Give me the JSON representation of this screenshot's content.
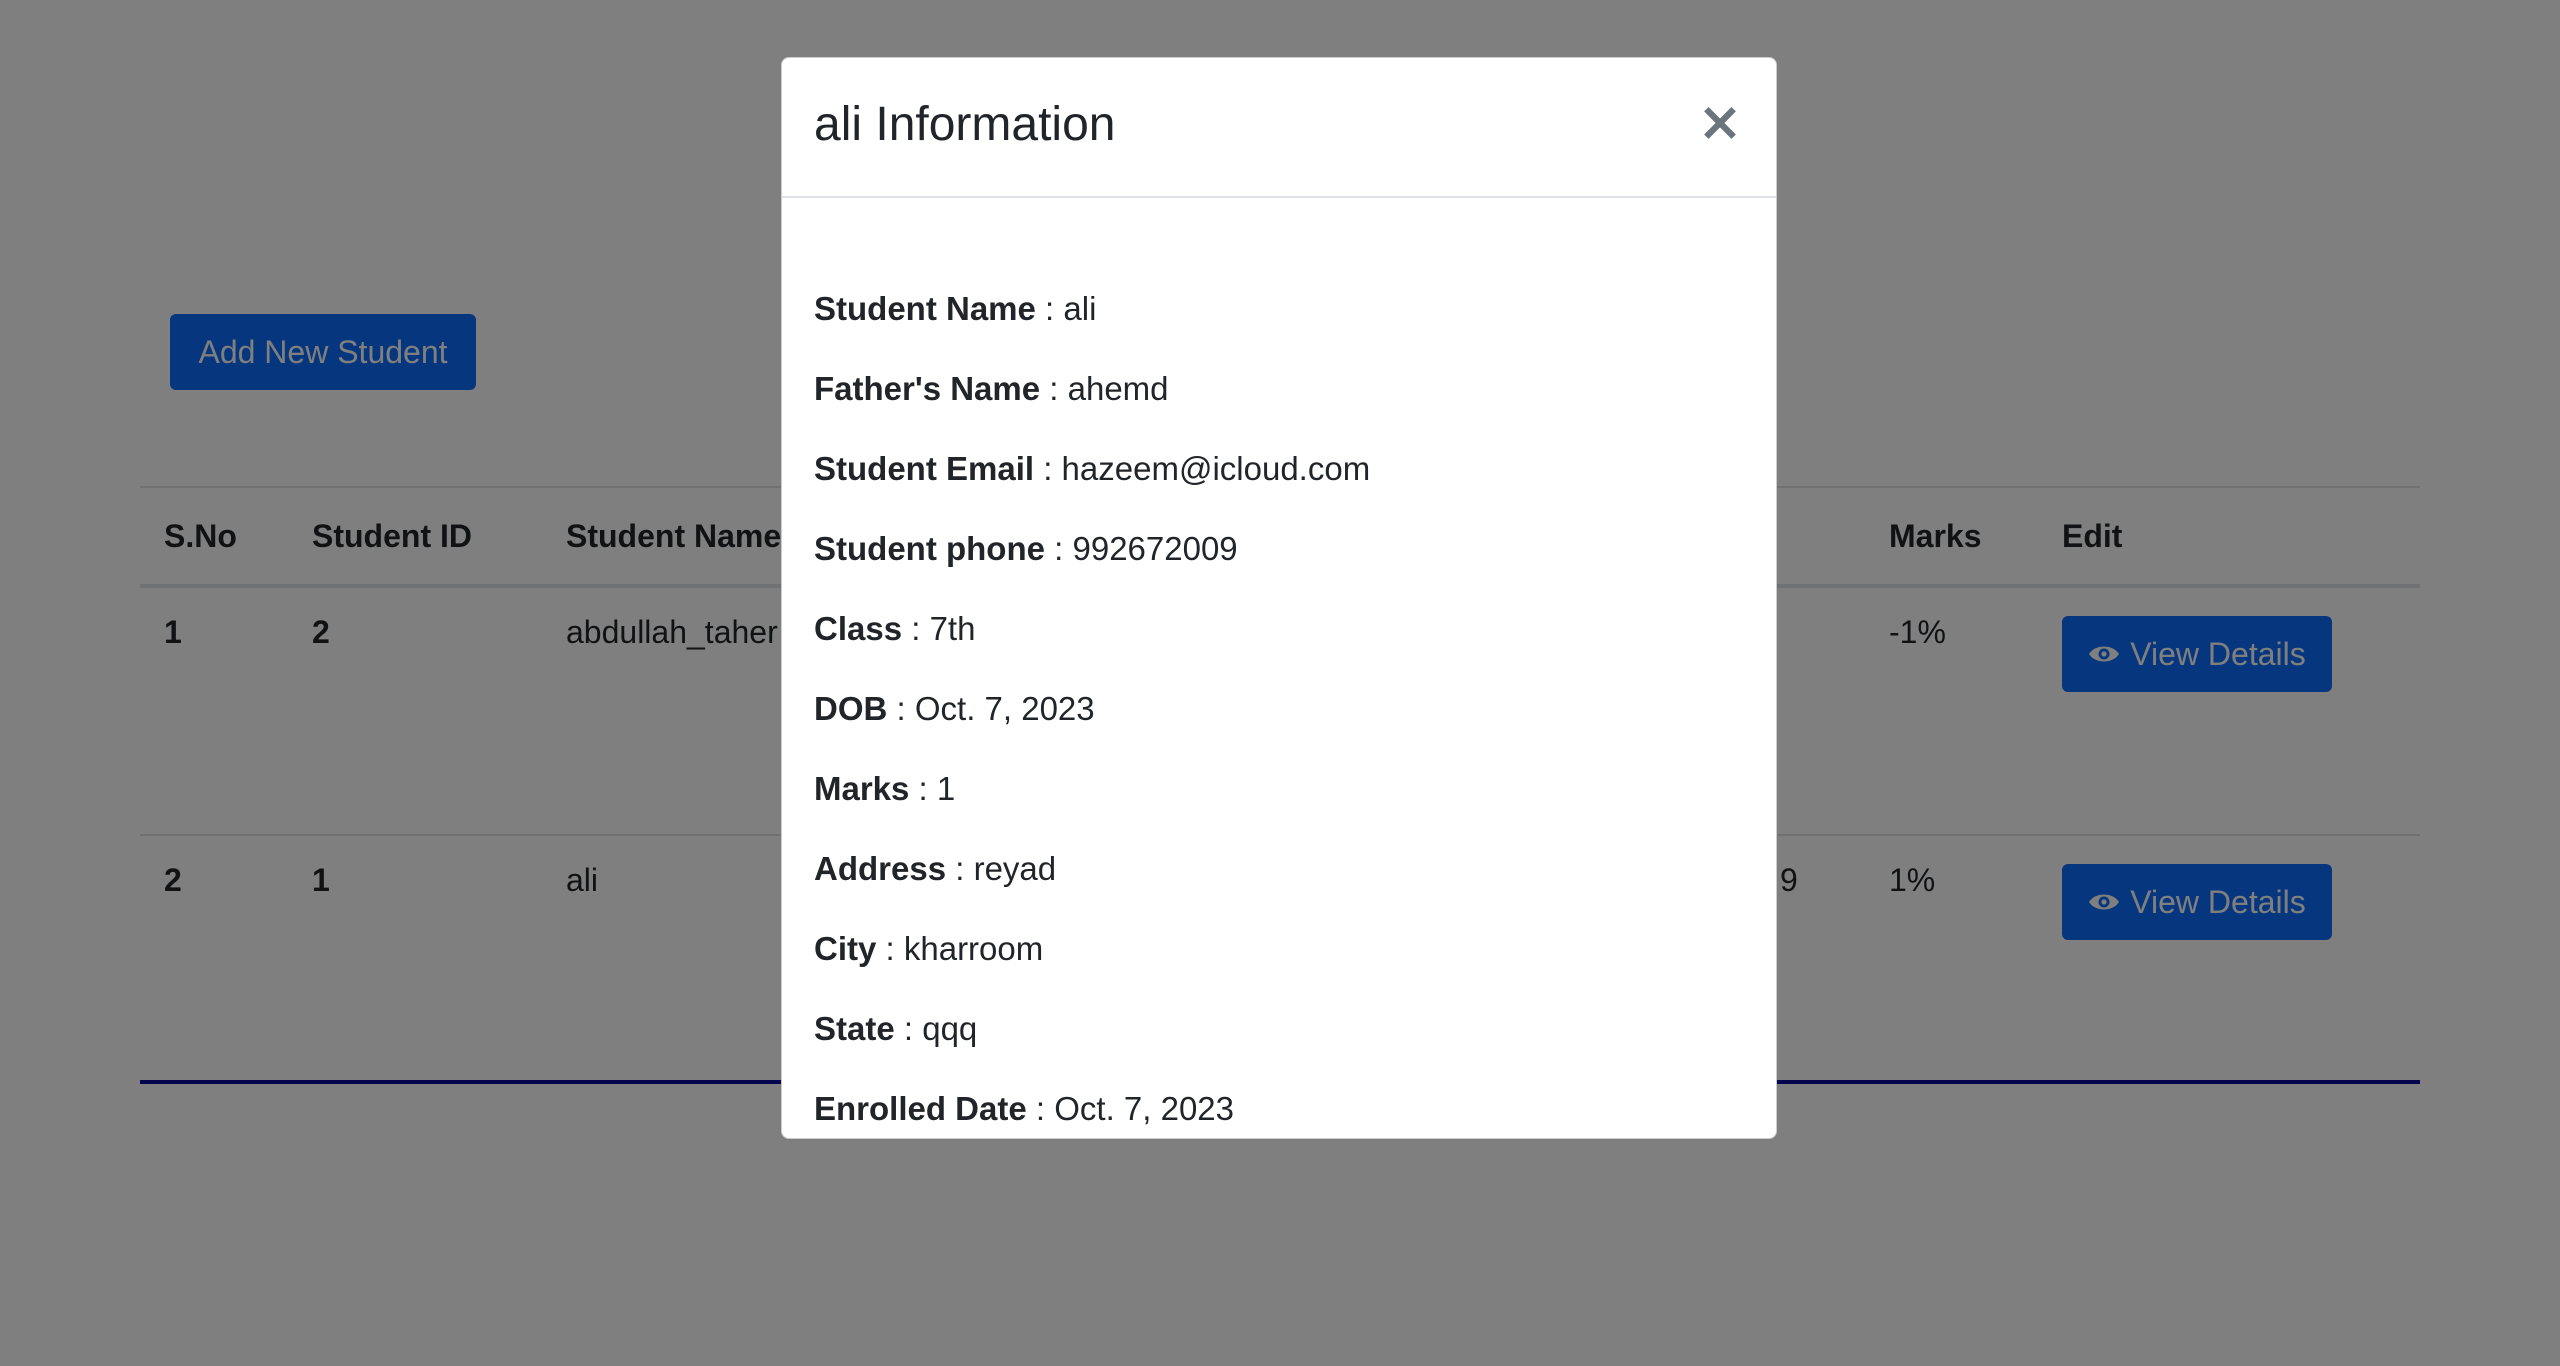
{
  "page": {
    "add_button_label": "Add New Student"
  },
  "table": {
    "headers": {
      "sno": "S.No",
      "student_id": "Student ID",
      "student_name": "Student Name",
      "marks": "Marks",
      "edit": "Edit"
    },
    "rows": [
      {
        "sno": "1",
        "student_id": "2",
        "student_name": "abdullah_taher",
        "partial_right": "",
        "marks": "-1%",
        "action_label": "View Details"
      },
      {
        "sno": "2",
        "student_id": "1",
        "student_name": "ali",
        "partial_right": "9",
        "marks": "1%",
        "action_label": "View Details"
      }
    ]
  },
  "modal": {
    "title": "ali Information",
    "close_label": "×",
    "separator": " : ",
    "fields": [
      {
        "label": "Student Name",
        "value": "ali"
      },
      {
        "label": "Father's Name",
        "value": "ahemd"
      },
      {
        "label": "Student Email",
        "value": "hazeem@icloud.com"
      },
      {
        "label": "Student phone",
        "value": "992672009"
      },
      {
        "label": "Class",
        "value": "7th"
      },
      {
        "label": "DOB",
        "value": "Oct. 7, 2023"
      },
      {
        "label": "Marks",
        "value": "1"
      },
      {
        "label": "Address",
        "value": "reyad"
      },
      {
        "label": "City",
        "value": "kharroom"
      },
      {
        "label": "State",
        "value": "qqq"
      },
      {
        "label": "Enrolled Date",
        "value": "Oct. 7, 2023"
      }
    ]
  },
  "colors": {
    "primary": "#0d6efd",
    "overlay": "rgba(0,0,0,0.5)",
    "footer_rule": "#0a0a9a"
  },
  "icons": {
    "view": "eye-icon",
    "close": "close-icon"
  }
}
